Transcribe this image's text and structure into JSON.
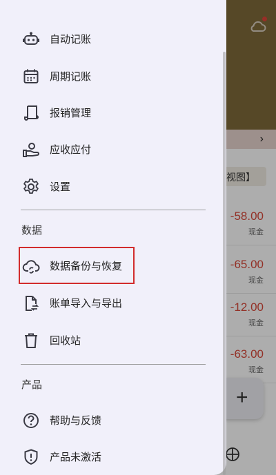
{
  "background": {
    "amounts": [
      {
        "amount": "-58.00",
        "method": "现金"
      },
      {
        "amount": "-65.00",
        "method": "现金"
      },
      {
        "amount": "-12.00",
        "method": "现金"
      },
      {
        "amount": "-63.00",
        "method": "现金"
      }
    ],
    "view_button_label": "视图】",
    "chevron": "›",
    "fab_label": "+"
  },
  "drawer": {
    "items_top": [
      {
        "label": "自动记账",
        "icon": "robot-icon"
      },
      {
        "label": "周期记账",
        "icon": "calendar-icon"
      },
      {
        "label": "报销管理",
        "icon": "receipt-icon"
      },
      {
        "label": "应收应付",
        "icon": "hand-pay-icon"
      },
      {
        "label": "设置",
        "icon": "gear-icon"
      }
    ],
    "section_data": {
      "title": "数据",
      "items": [
        {
          "label": "数据备份与恢复",
          "icon": "cloud-sync-icon"
        },
        {
          "label": "账单导入与导出",
          "icon": "file-transfer-icon"
        },
        {
          "label": "回收站",
          "icon": "trash-icon"
        }
      ]
    },
    "section_product": {
      "title": "产品",
      "items": [
        {
          "label": "帮助与反馈",
          "icon": "help-icon"
        },
        {
          "label": "产品未激活",
          "icon": "shield-icon"
        }
      ]
    }
  },
  "colors": {
    "header": "#7f6a3a",
    "drawer_bg": "#f1f0fa",
    "highlight": "#d22c2c",
    "amount": "#d94a3c"
  }
}
